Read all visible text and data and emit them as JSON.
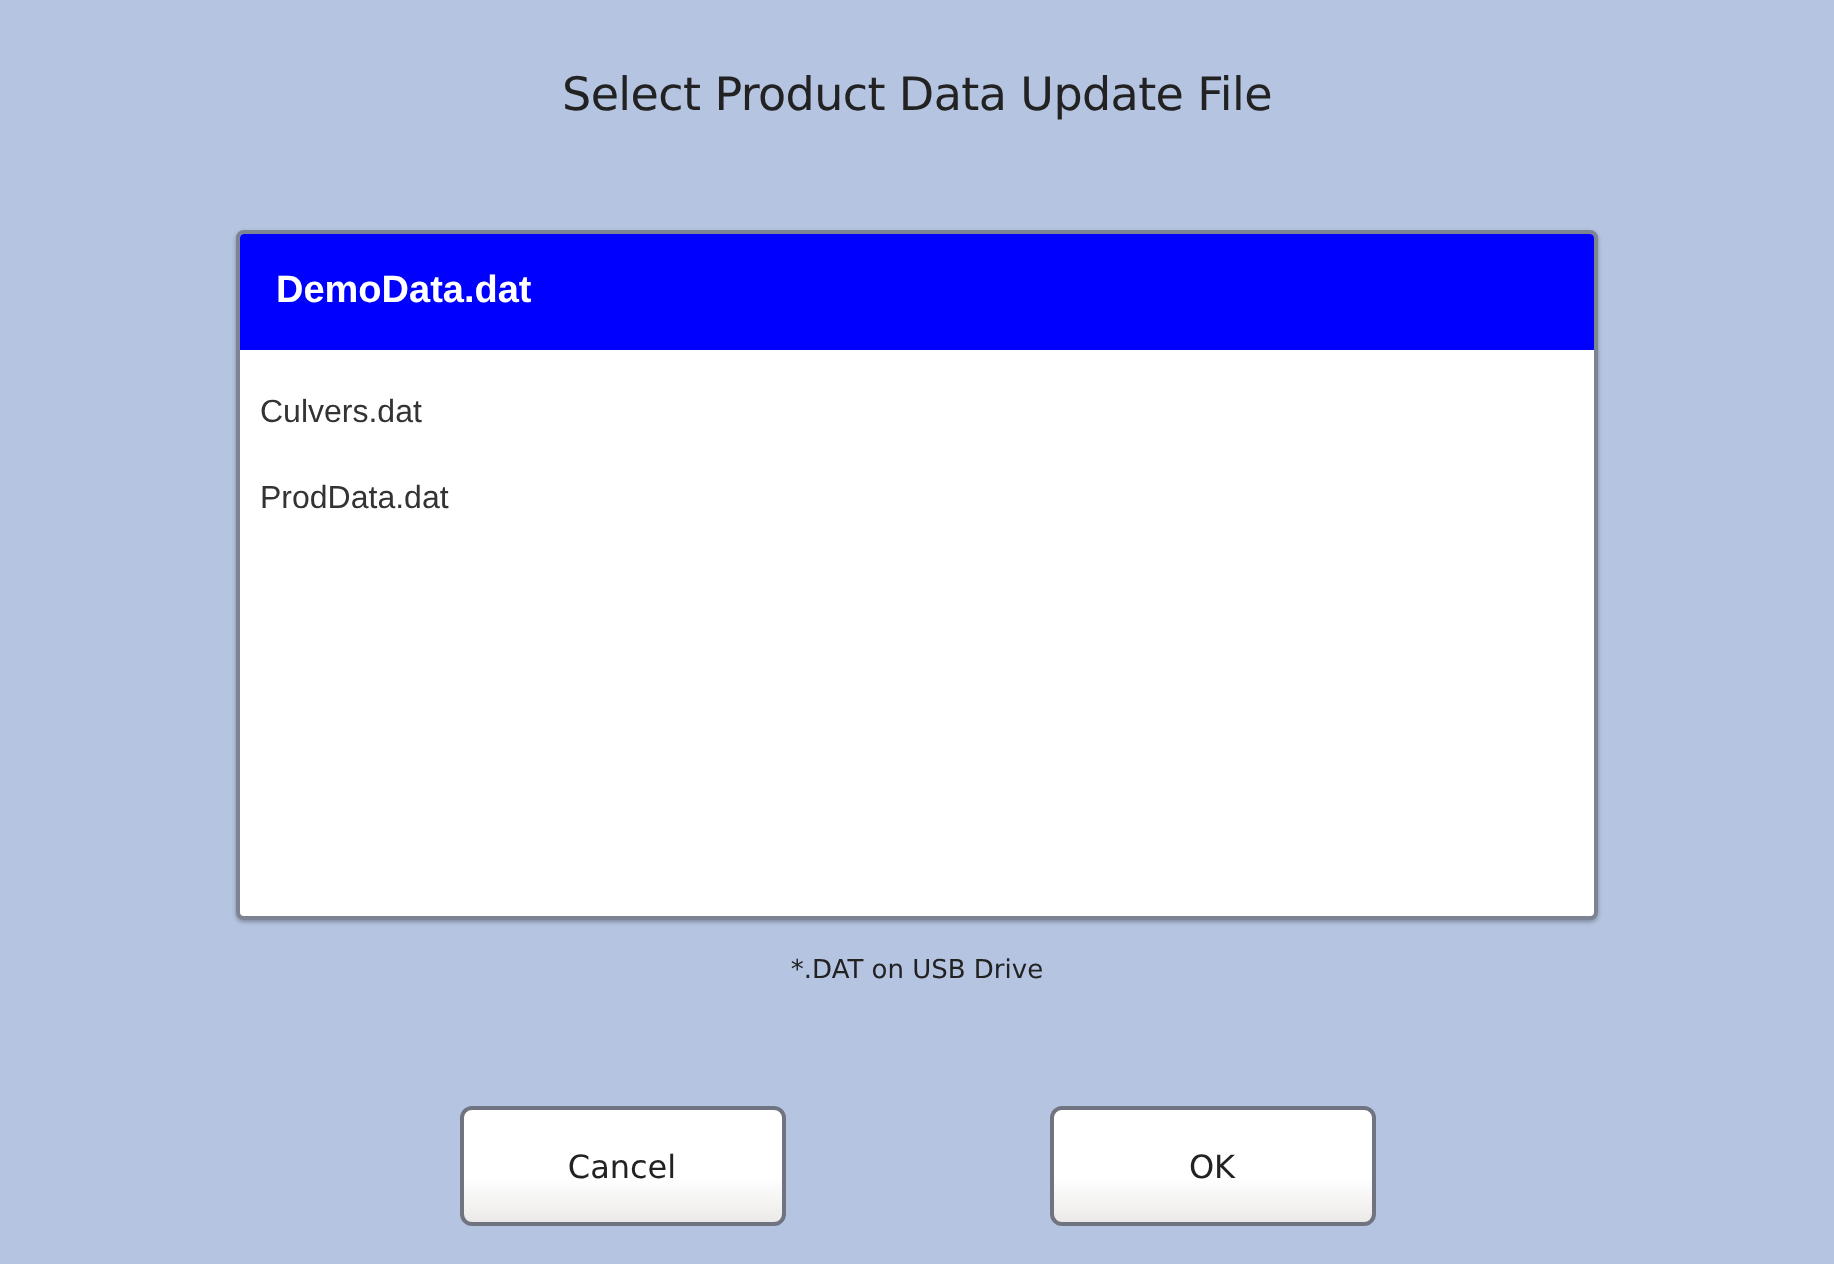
{
  "dialog": {
    "title": "Select Product Data Update File"
  },
  "files": [
    {
      "name": "DemoData.dat",
      "selected": true
    },
    {
      "name": "Culvers.dat",
      "selected": false
    },
    {
      "name": "ProdData.dat",
      "selected": false
    }
  ],
  "caption": "*.DAT on USB Drive",
  "buttons": [
    {
      "label": "Cancel"
    },
    {
      "label": "OK"
    }
  ]
}
